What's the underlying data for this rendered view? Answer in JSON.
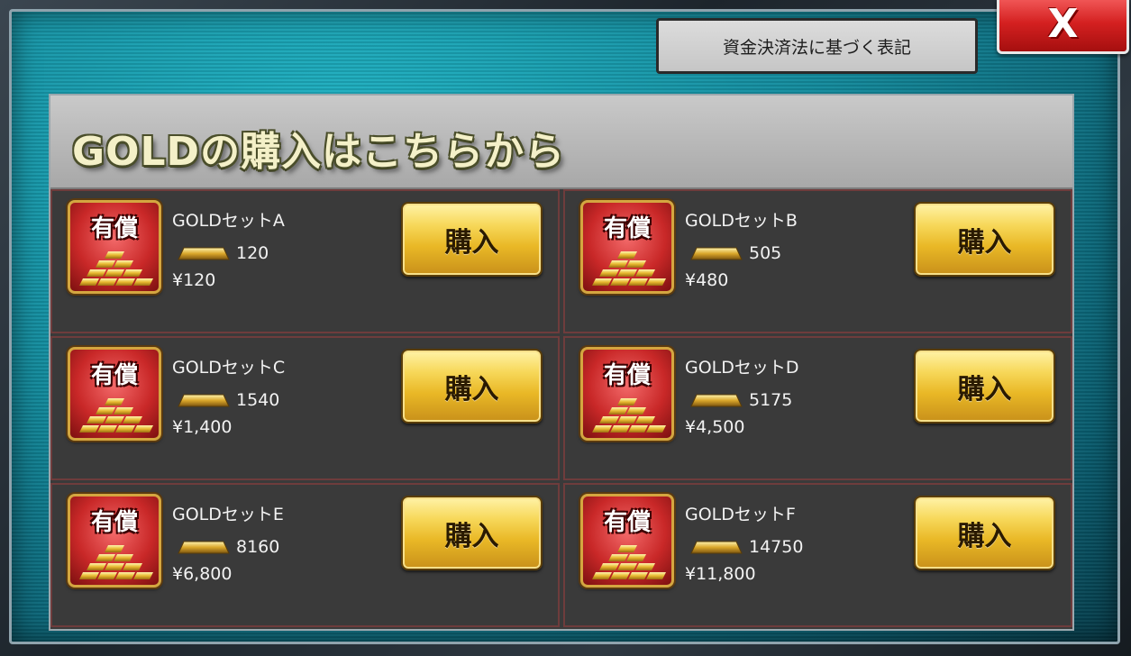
{
  "legal_notice_label": "資金決済法に基づく表記",
  "close_label": "X",
  "header_title": "GOLDの購入はこちらから",
  "items": [
    {
      "badge": "有償",
      "name": "GOLDセットA",
      "gold": "120",
      "price": "¥120",
      "buy_label": "購入"
    },
    {
      "badge": "有償",
      "name": "GOLDセットB",
      "gold": "505",
      "price": "¥480",
      "buy_label": "購入"
    },
    {
      "badge": "有償",
      "name": "GOLDセットC",
      "gold": "1540",
      "price": "¥1,400",
      "buy_label": "購入"
    },
    {
      "badge": "有償",
      "name": "GOLDセットD",
      "gold": "5175",
      "price": "¥4,500",
      "buy_label": "購入"
    },
    {
      "badge": "有償",
      "name": "GOLDセットE",
      "gold": "8160",
      "price": "¥6,800",
      "buy_label": "購入"
    },
    {
      "badge": "有償",
      "name": "GOLDセットF",
      "gold": "14750",
      "price": "¥11,800",
      "buy_label": "購入"
    }
  ],
  "colors": {
    "panel_teal": "#138a9c",
    "close_red": "#d42020",
    "buy_gold": "#e9b826",
    "cell_bg": "#3a3a3a"
  }
}
